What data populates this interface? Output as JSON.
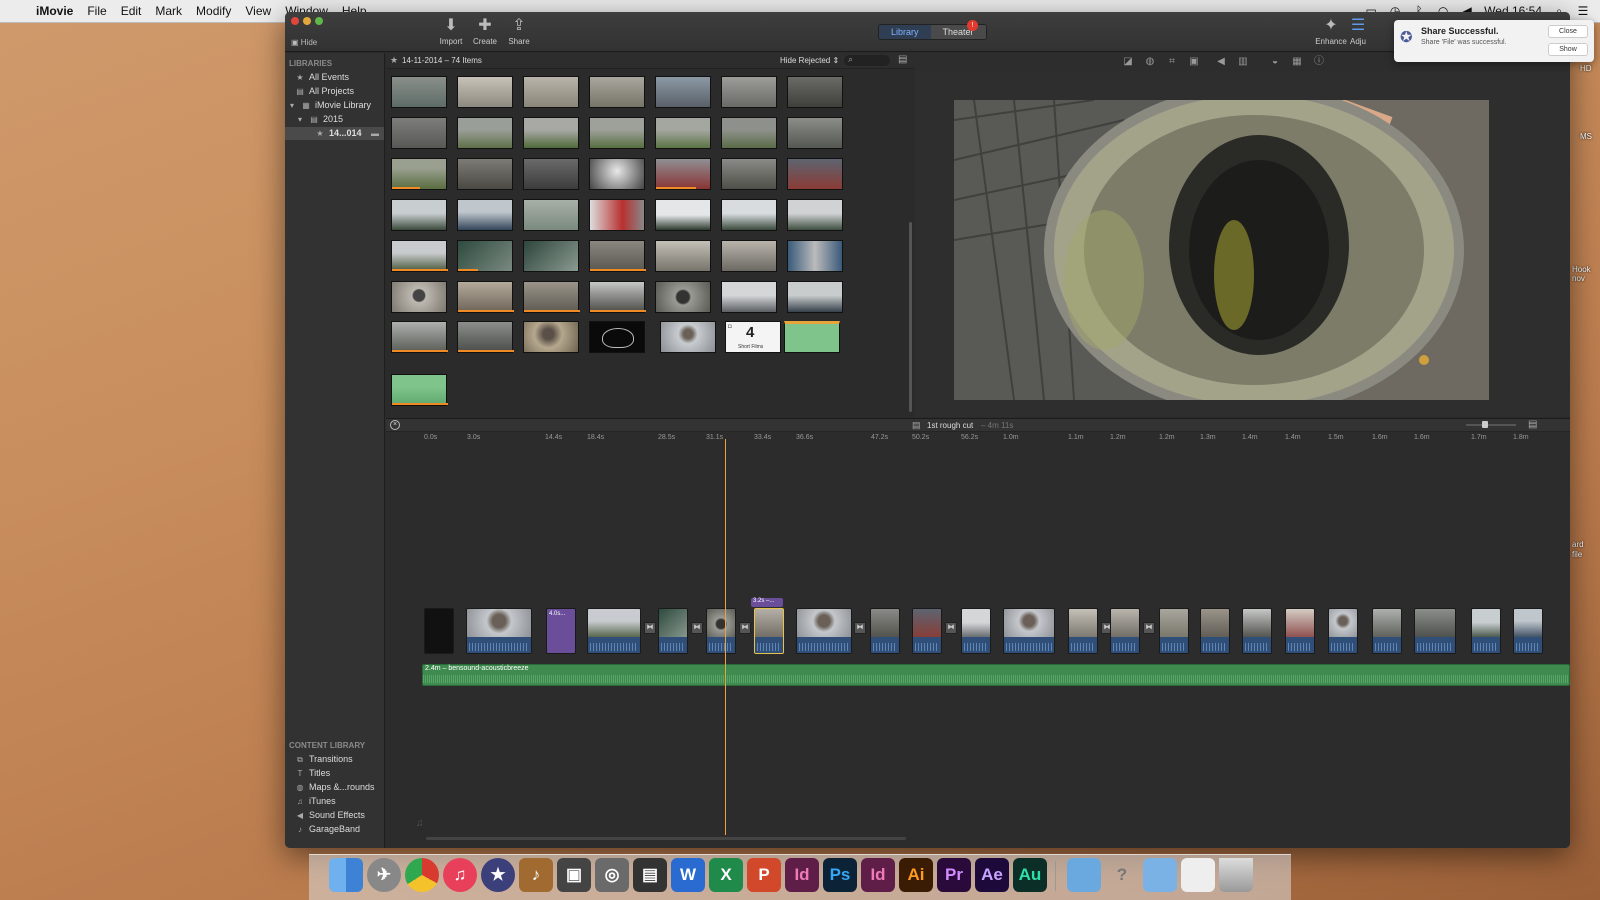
{
  "menubar": {
    "app": "iMovie",
    "items": [
      "File",
      "Edit",
      "Mark",
      "Modify",
      "View",
      "Window",
      "Help"
    ],
    "clock": "Wed 16:54"
  },
  "toolbar": {
    "hide": "Hide",
    "import": "Import",
    "create": "Create",
    "share": "Share",
    "library_tab": "Library",
    "theater_tab": "Theater",
    "theater_badge": "!",
    "enhance": "Enhance",
    "adjust": "Adju"
  },
  "sidebar": {
    "libraries_header": "LIBRARIES",
    "items": [
      "All Events",
      "All Projects",
      "iMovie Library",
      "2015",
      "14...014"
    ],
    "content_header": "CONTENT LIBRARY",
    "content_items": [
      "Transitions",
      "Titles",
      "Maps &...rounds",
      "iTunes",
      "Sound Effects",
      "GarageBand"
    ]
  },
  "browser": {
    "event_title": "14-11-2014 – 74 Items",
    "filter": "Hide Rejected",
    "thumb_title_card": "Short Films"
  },
  "timeline": {
    "project_title": "1st rough cut",
    "duration": "– 4m 11s",
    "ticks": [
      "0.0s",
      "3.0s",
      "14.4s",
      "18.4s",
      "28.5s",
      "31.1s",
      "33.4s",
      "36.6s",
      "47.2s",
      "50.2s",
      "56.2s",
      "1.0m",
      "1.1m",
      "1.2m",
      "1.2m",
      "1.3m",
      "1.4m",
      "1.4m",
      "1.5m",
      "1.6m",
      "1.6m",
      "1.7m",
      "1.8m"
    ],
    "title_clip_label": "4.0s...",
    "selected_clip_label": "3.2s –...",
    "music_label": "2.4m – bensound-acousticbreeze"
  },
  "notification": {
    "title": "Share Successful.",
    "body": "Share 'File' was successful.",
    "close": "Close",
    "show": "Show"
  },
  "desktop": {
    "labels": [
      "HD",
      "MS",
      "Hook",
      "nov",
      "ard",
      "file"
    ]
  },
  "dock": {
    "letter_apps": [
      "W",
      "X",
      "P",
      "Id",
      "Ps",
      "Id",
      "Ai",
      "Pr",
      "Ae",
      "Au"
    ]
  },
  "colors": {
    "accent": "#7fb1ff",
    "playhead": "#f0a040",
    "music": "#3f8a4e",
    "audio": "#2f4f78"
  }
}
